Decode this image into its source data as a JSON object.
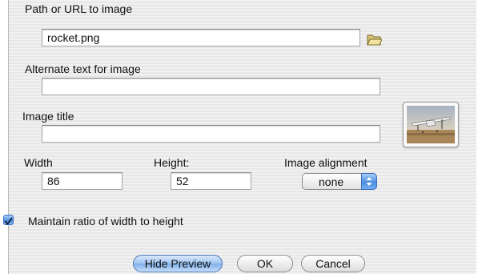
{
  "image_path": {
    "label": "Path or URL to image",
    "value": "rocket.png"
  },
  "alt_text": {
    "label": "Alternate text for image",
    "value": ""
  },
  "image_title": {
    "label": "Image title",
    "value": ""
  },
  "width": {
    "label": "Width",
    "value": "86"
  },
  "height": {
    "label": "Height:",
    "value": "52"
  },
  "alignment": {
    "label": "Image alignment",
    "value": "none"
  },
  "maintain_ratio": {
    "label": "Maintain ratio of width to height",
    "checked": true
  },
  "buttons": {
    "hide_preview": "Hide Preview",
    "ok": "OK",
    "cancel": "Cancel"
  },
  "icons": {
    "browse": "folder-open-icon",
    "checkmark": "checkmark-icon",
    "popup_arrows": "updown-arrows-icon"
  },
  "colors": {
    "accent": "#4d8fe0",
    "background": "#ececec"
  }
}
